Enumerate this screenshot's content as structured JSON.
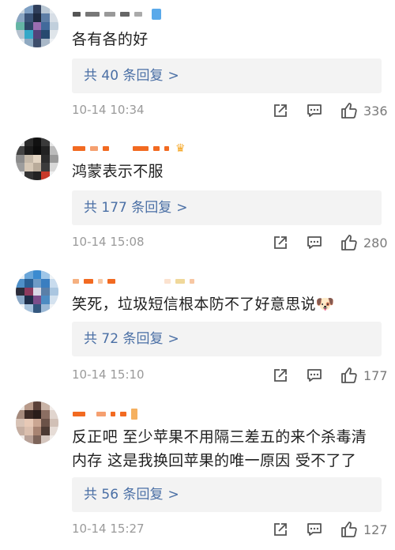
{
  "comments": [
    {
      "text": "各有各的好",
      "replies": "共 40 条回复",
      "chevron": ">",
      "time": "10-14 10:34",
      "likes": "336"
    },
    {
      "text": "鸿蒙表示不服",
      "replies": "共 177 条回复",
      "chevron": ">",
      "time": "10-14 15:08",
      "likes": "280"
    },
    {
      "text": "笑死，垃圾短信根本防不了好意思说🐶",
      "replies": "共 72 条回复",
      "chevron": ">",
      "time": "10-14 15:10",
      "likes": "177"
    },
    {
      "text": "反正吧 至少苹果不用隔三差五的来个杀毒清内存 这是我换回苹果的唯一原因 受不了了",
      "replies": "共 56 条回复",
      "chevron": ">",
      "time": "10-14 15:27",
      "likes": "127"
    }
  ],
  "icons": [
    "share-icon",
    "comment-icon",
    "like-icon",
    "crown-icon"
  ],
  "colors": {
    "reply_link": "#4a6fa5",
    "reply_bg": "#f3f3f3",
    "timestamp": "#9a9a9a",
    "username_orange": "#f26a21"
  }
}
